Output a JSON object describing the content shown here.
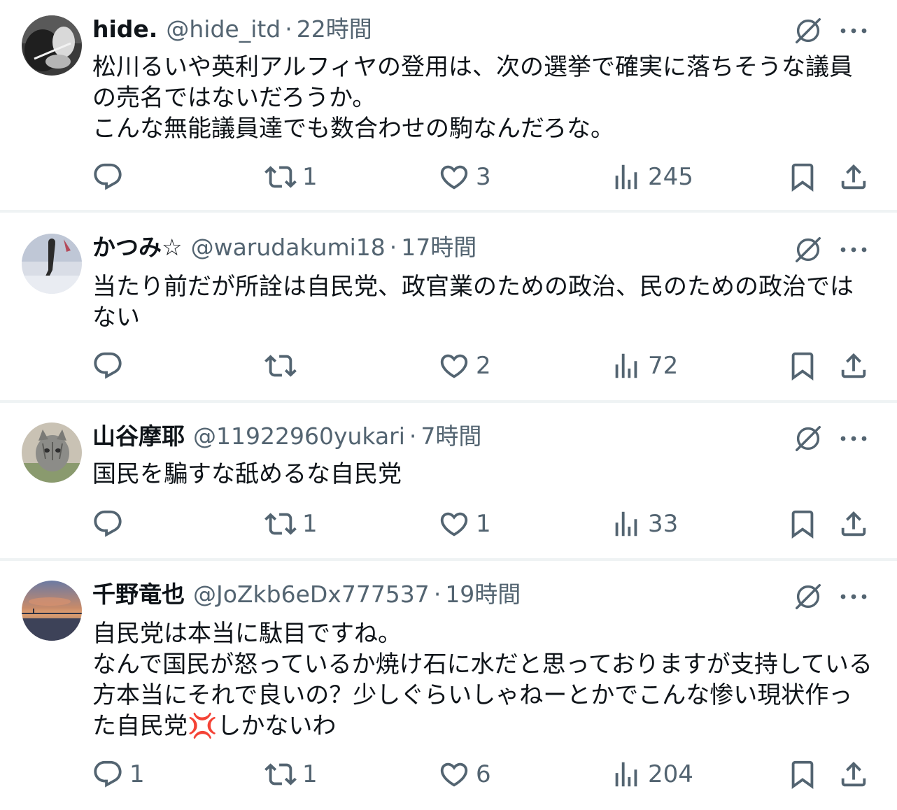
{
  "tweets": [
    {
      "name": "hide.",
      "handle": "@hide_itd",
      "dot": "·",
      "time": "22時間",
      "text": "松川るいや英利アルフィヤの登用は、次の選挙で確実に落ちそうな議員の売名ではないだろうか。\nこんな無能議員達でも数合わせの駒なんだろな。",
      "replies": "",
      "retweets": "1",
      "likes": "3",
      "views": "245"
    },
    {
      "name": "かつみ☆",
      "handle": "@warudakumi18",
      "dot": "·",
      "time": "17時間",
      "text": "当たり前だが所詮は自民党、政官業のための政治、民のための政治ではない",
      "replies": "",
      "retweets": "",
      "likes": "2",
      "views": "72"
    },
    {
      "name": "山谷摩耶",
      "handle": "@11922960yukari",
      "dot": "·",
      "time": "7時間",
      "text": "国民を騙すな舐めるな自民党",
      "replies": "",
      "retweets": "1",
      "likes": "1",
      "views": "33"
    },
    {
      "name": "千野竜也",
      "handle": "@JoZkb6eDx777537",
      "dot": "·",
      "time": "19時間",
      "text": "自民党は本当に駄目ですね。\nなんで国民が怒っているか焼け石に水だと思っておりますが支持している方本当にそれで良いの？少しぐらいしゃねーとかでこんな惨い現状作った自民党💢しかないわ",
      "replies": "1",
      "retweets": "1",
      "likes": "6",
      "views": "204"
    }
  ],
  "icons": {
    "grok": "grok-icon",
    "more": "more-icon",
    "reply": "reply-icon",
    "retweet": "retweet-icon",
    "like": "like-icon",
    "views": "views-icon",
    "bookmark": "bookmark-icon",
    "share": "share-icon"
  },
  "colors": {
    "text": "#0f1419",
    "secondary": "#536471",
    "divider": "#eff3f4"
  }
}
